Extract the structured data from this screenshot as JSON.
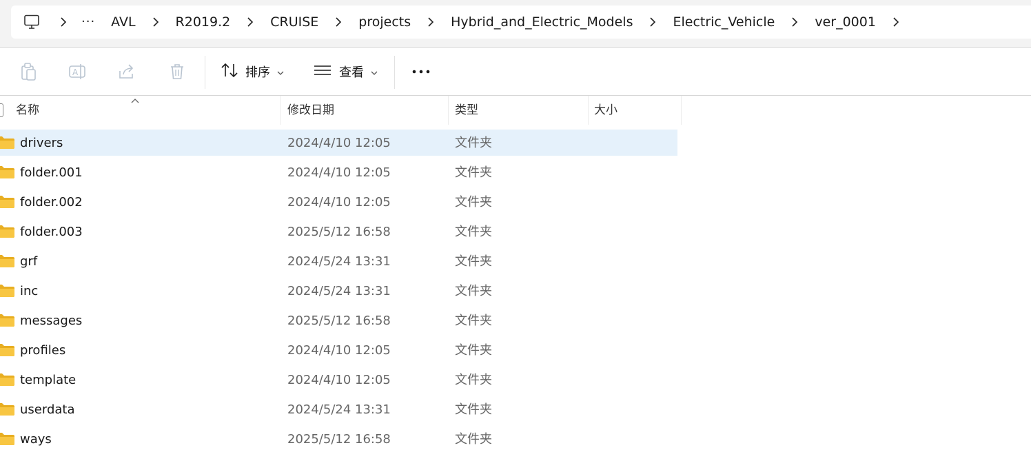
{
  "breadcrumb": {
    "overflow_label": "···",
    "items": [
      "AVL",
      "R2019.2",
      "CRUISE",
      "projects",
      "Hybrid_and_Electric_Models",
      "Electric_Vehicle",
      "ver_0001"
    ]
  },
  "toolbar": {
    "sort_label": "排序",
    "view_label": "查看"
  },
  "columns": {
    "name": "名称",
    "modified": "修改日期",
    "type": "类型",
    "size": "大小"
  },
  "files": [
    {
      "name": "drivers",
      "modified": "2024/4/10 12:05",
      "type": "文件夹",
      "size": "",
      "selected": true
    },
    {
      "name": "folder.001",
      "modified": "2024/4/10 12:05",
      "type": "文件夹",
      "size": ""
    },
    {
      "name": "folder.002",
      "modified": "2024/4/10 12:05",
      "type": "文件夹",
      "size": ""
    },
    {
      "name": "folder.003",
      "modified": "2025/5/12 16:58",
      "type": "文件夹",
      "size": ""
    },
    {
      "name": "grf",
      "modified": "2024/5/24 13:31",
      "type": "文件夹",
      "size": ""
    },
    {
      "name": "inc",
      "modified": "2024/5/24 13:31",
      "type": "文件夹",
      "size": ""
    },
    {
      "name": "messages",
      "modified": "2025/5/12 16:58",
      "type": "文件夹",
      "size": ""
    },
    {
      "name": "profiles",
      "modified": "2024/4/10 12:05",
      "type": "文件夹",
      "size": ""
    },
    {
      "name": "template",
      "modified": "2024/4/10 12:05",
      "type": "文件夹",
      "size": ""
    },
    {
      "name": "userdata",
      "modified": "2024/5/24 13:31",
      "type": "文件夹",
      "size": ""
    },
    {
      "name": "ways",
      "modified": "2025/5/12 16:58",
      "type": "文件夹",
      "size": ""
    }
  ],
  "colors": {
    "selection": "#e5f1fb",
    "folder_fill": "#f8c642",
    "folder_tab": "#e8ae21"
  },
  "icons": {
    "root": "computer-icon",
    "separator": "chevron-right-icon",
    "copy": "copy-icon",
    "rename": "rename-icon",
    "share": "share-icon",
    "delete": "delete-icon",
    "sort": "sort-icon",
    "view": "view-list-icon",
    "more": "more-icon",
    "folder": "folder-icon"
  }
}
